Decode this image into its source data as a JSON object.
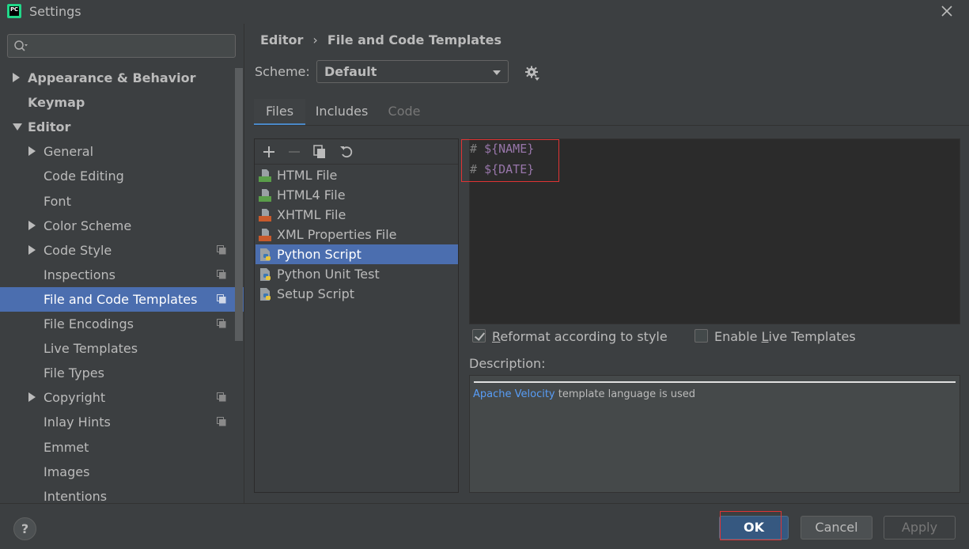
{
  "window": {
    "app_icon_text": "PC",
    "title": "Settings"
  },
  "sidebar": {
    "search_placeholder": "",
    "items": [
      {
        "label": "Appearance & Behavior",
        "level": 0,
        "expander": "collapsed",
        "bold": true,
        "selected": false,
        "has_copy_icon": false
      },
      {
        "label": "Keymap",
        "level": 0,
        "expander": "none",
        "bold": true,
        "selected": false,
        "has_copy_icon": false
      },
      {
        "label": "Editor",
        "level": 0,
        "expander": "expanded",
        "bold": true,
        "selected": false,
        "has_copy_icon": false
      },
      {
        "label": "General",
        "level": 1,
        "expander": "collapsed",
        "bold": false,
        "selected": false,
        "has_copy_icon": false
      },
      {
        "label": "Code Editing",
        "level": 1,
        "expander": "none",
        "bold": false,
        "selected": false,
        "has_copy_icon": false
      },
      {
        "label": "Font",
        "level": 1,
        "expander": "none",
        "bold": false,
        "selected": false,
        "has_copy_icon": false
      },
      {
        "label": "Color Scheme",
        "level": 1,
        "expander": "collapsed",
        "bold": false,
        "selected": false,
        "has_copy_icon": false
      },
      {
        "label": "Code Style",
        "level": 1,
        "expander": "collapsed",
        "bold": false,
        "selected": false,
        "has_copy_icon": true
      },
      {
        "label": "Inspections",
        "level": 1,
        "expander": "none",
        "bold": false,
        "selected": false,
        "has_copy_icon": true
      },
      {
        "label": "File and Code Templates",
        "level": 1,
        "expander": "none",
        "bold": false,
        "selected": true,
        "has_copy_icon": true
      },
      {
        "label": "File Encodings",
        "level": 1,
        "expander": "none",
        "bold": false,
        "selected": false,
        "has_copy_icon": true
      },
      {
        "label": "Live Templates",
        "level": 1,
        "expander": "none",
        "bold": false,
        "selected": false,
        "has_copy_icon": false
      },
      {
        "label": "File Types",
        "level": 1,
        "expander": "none",
        "bold": false,
        "selected": false,
        "has_copy_icon": false
      },
      {
        "label": "Copyright",
        "level": 1,
        "expander": "collapsed",
        "bold": false,
        "selected": false,
        "has_copy_icon": true
      },
      {
        "label": "Inlay Hints",
        "level": 1,
        "expander": "none",
        "bold": false,
        "selected": false,
        "has_copy_icon": true
      },
      {
        "label": "Emmet",
        "level": 1,
        "expander": "none",
        "bold": false,
        "selected": false,
        "has_copy_icon": false
      },
      {
        "label": "Images",
        "level": 1,
        "expander": "none",
        "bold": false,
        "selected": false,
        "has_copy_icon": false
      },
      {
        "label": "Intentions",
        "level": 1,
        "expander": "none",
        "bold": false,
        "selected": false,
        "has_copy_icon": false
      }
    ]
  },
  "breadcrumb": {
    "parent": "Editor",
    "separator": "›",
    "current": "File and Code Templates"
  },
  "scheme": {
    "label": "Scheme:",
    "value": "Default"
  },
  "tabs": [
    {
      "label": "Files",
      "state": "active"
    },
    {
      "label": "Includes",
      "state": "normal"
    },
    {
      "label": "Code",
      "state": "disabled"
    }
  ],
  "files": [
    {
      "name": "HTML File",
      "icon": "html-file-icon",
      "icon_color": "#5a9e4a",
      "selected": false
    },
    {
      "name": "HTML4 File",
      "icon": "html-file-icon",
      "icon_color": "#5a9e4a",
      "selected": false
    },
    {
      "name": "XHTML File",
      "icon": "xhtml-file-icon",
      "icon_color": "#c75a2c",
      "selected": false
    },
    {
      "name": "XML Properties File",
      "icon": "xml-file-icon",
      "icon_color": "#c75a2c",
      "selected": false
    },
    {
      "name": "Python Script",
      "icon": "python-file-icon",
      "icon_color": "#3c78b4",
      "selected": true
    },
    {
      "name": "Python Unit Test",
      "icon": "python-file-icon",
      "icon_color": "#3c78b4",
      "selected": false
    },
    {
      "name": "Setup Script",
      "icon": "python-file-icon",
      "icon_color": "#3c78b4",
      "selected": false
    }
  ],
  "editor": {
    "lines": [
      {
        "hash": "# ",
        "var": "${NAME}"
      },
      {
        "hash": "# ",
        "var": "${DATE}"
      }
    ]
  },
  "options": {
    "reformat": {
      "label": "Reformat according to style",
      "mnemonic": "R",
      "checked": true
    },
    "live_templates": {
      "label_before": "Enable ",
      "mnemonic": "L",
      "label_after": "ive Templates",
      "checked": false
    }
  },
  "description": {
    "label": "Description:",
    "link_text": "Apache Velocity",
    "rest_text": " template language is used"
  },
  "buttons": {
    "help": "?",
    "ok": "OK",
    "cancel": "Cancel",
    "apply": "Apply"
  },
  "colors": {
    "background": "#3c3f41",
    "selection": "#4b6eaf",
    "editor_bg": "#2b2b2b",
    "template_var": "#9876aa",
    "link": "#589df6",
    "annotation_red": "#e03434"
  }
}
